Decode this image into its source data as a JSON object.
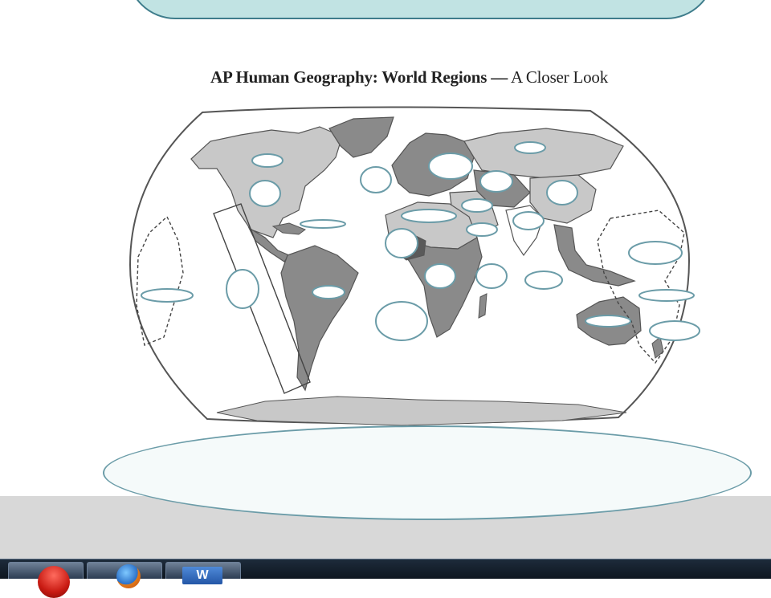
{
  "banner": {},
  "map": {
    "title_bold": "AP Human Geography: World Regions —",
    "title_rest": " A Closer Look",
    "colors": {
      "ocean": "#ffffff",
      "outline": "#555555",
      "light_land": "#c8c8c8",
      "mid_land": "#8a8a8a",
      "dark_land": "#5a5a5a",
      "label_oval_fill": "#ffffff",
      "label_oval_border": "#6b9ca8"
    }
  },
  "answer_box": {},
  "taskbar": {
    "items": [
      {
        "name": "start-button",
        "icon": "windows-orb-icon"
      },
      {
        "name": "firefox-task",
        "icon": "firefox-icon"
      },
      {
        "name": "word-task",
        "icon": "word-icon",
        "glyph": "W"
      }
    ]
  }
}
